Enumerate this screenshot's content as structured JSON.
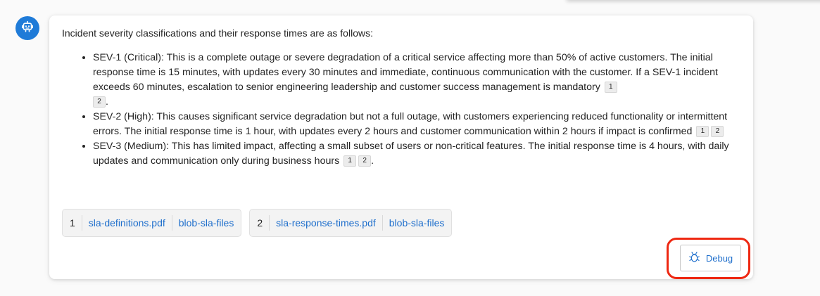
{
  "assistant": {
    "avatar_icon": "bot-icon",
    "accent": "#1f7bd8"
  },
  "answer": {
    "intro": "Incident severity classifications and their response times are as follows:",
    "items": [
      {
        "text": "SEV-1 (Critical): This is a complete outage or severe degradation of a critical service affecting more than 50% of active customers. The initial response time is 15 minutes, with updates every 30 minutes and immediate, continuous communication with the customer. If a SEV-1 incident exceeds 60 minutes, escalation to senior engineering leadership and customer success management is mandatory",
        "citations": [
          "1",
          "2"
        ],
        "suffix": "."
      },
      {
        "text": "SEV-2 (High): This causes significant service degradation but not a full outage, with customers experiencing reduced functionality or intermittent errors. The initial response time is 1 hour, with updates every 2 hours and customer communication within 2 hours if impact is confirmed",
        "citations": [
          "1",
          "2"
        ],
        "suffix": ""
      },
      {
        "text": "SEV-3 (Medium): This has limited impact, affecting a small subset of users or non-critical features. The initial response time is 4 hours, with daily updates and communication only during business hours",
        "citations": [
          "1",
          "2"
        ],
        "suffix": "."
      }
    ]
  },
  "sources": [
    {
      "num": "1",
      "file": "sla-definitions.pdf",
      "container": "blob-sla-files"
    },
    {
      "num": "2",
      "file": "sla-response-times.pdf",
      "container": "blob-sla-files"
    }
  ],
  "debug": {
    "label": "Debug",
    "icon": "bug-icon",
    "highlight_color": "#ee2812"
  },
  "colors": {
    "link": "#1f6fcc",
    "text": "#242424"
  }
}
